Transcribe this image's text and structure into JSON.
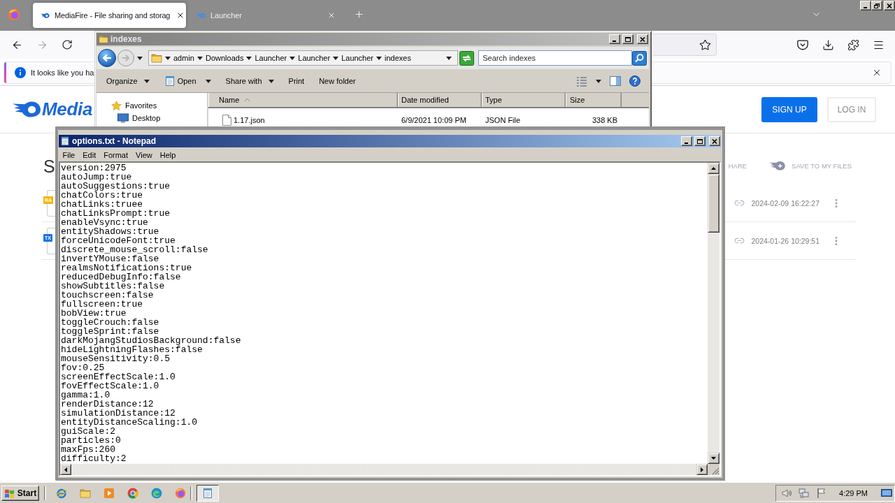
{
  "browser": {
    "tabs": [
      {
        "title": "MediaFire - File sharing and storag",
        "selected": true
      },
      {
        "title": "Launcher",
        "selected": false
      }
    ],
    "notification": {
      "text": "It looks like you ha"
    }
  },
  "page": {
    "logo": "Media",
    "buttons": [
      {
        "label": "SIGN UP",
        "kind": "primary"
      },
      {
        "label": "LOG IN",
        "kind": "secondary"
      }
    ],
    "heading": "S",
    "actions": [
      {
        "label": "HARE",
        "kind": "share"
      },
      {
        "label": "SAVE TO MY FILES",
        "kind": "save"
      }
    ],
    "files": [
      {
        "badge": "RA",
        "color": "#f2b705",
        "modified": "2024-02-09 16:22:27"
      },
      {
        "badge": "TX",
        "color": "#1a73e8",
        "modified": "2024-01-26 10:29:51"
      }
    ]
  },
  "explorer": {
    "title": "indexes",
    "breadcrumb": [
      "admin",
      "Downloads",
      "Launcher",
      "Launcher",
      "Launcher",
      "indexes"
    ],
    "search": {
      "placeholder": "Search indexes"
    },
    "toolbar": [
      {
        "label": "Organize",
        "kind": "menu"
      },
      {
        "label": "Open",
        "kind": "open"
      },
      {
        "label": "Share with",
        "kind": "menu"
      },
      {
        "label": "Print",
        "kind": "plain"
      },
      {
        "label": "New folder",
        "kind": "plain"
      }
    ],
    "nav": [
      {
        "label": "Favorites",
        "kind": "group"
      },
      {
        "label": "Desktop",
        "kind": "item"
      }
    ],
    "columns": [
      {
        "label": "Name",
        "sorted": true
      },
      {
        "label": "Date modified",
        "sorted": false
      },
      {
        "label": "Type",
        "sorted": false
      },
      {
        "label": "Size",
        "sorted": false
      }
    ],
    "rows": [
      {
        "name": "1.17.json",
        "modified": "6/9/2021 10:09 PM",
        "type": "JSON File",
        "size": "338 KB"
      }
    ]
  },
  "notepad": {
    "title": "options.txt - Notepad",
    "menu": [
      "File",
      "Edit",
      "Format",
      "View",
      "Help"
    ],
    "lines": [
      "version:2975",
      "autoJump:true",
      "autoSuggestions:true",
      "chatColors:true",
      "chatLinks:truee",
      "chatLinksPrompt:true",
      "enableVsync:true",
      "entityShadows:true",
      "forceUnicodeFont:true",
      "discrete_mouse_scroll:false",
      "invertYMouse:false",
      "realmsNotifications:true",
      "reducedDebugInfo:false",
      "showSubtitles:false",
      "touchscreen:false",
      "fullscreen:true",
      "bobView:true",
      "toggleCrouch:false",
      "toggleSprint:false",
      "darkMojangStudiosBackground:false",
      "hideLightningFlashes:false",
      "mouseSensitivity:0.5",
      "fov:0.25",
      "screenEffectScale:1.0",
      "fovEffectScale:1.0",
      "gamma:1.0",
      "renderDistance:12",
      "simulationDistance:12",
      "entityDistanceScaling:1.0",
      "guiScale:2",
      "particles:0",
      "maxFps:260",
      "difficulty:2"
    ]
  },
  "taskbar": {
    "start": "Start",
    "tasks": [
      {
        "selected": true
      }
    ],
    "clock": "4:29 PM"
  }
}
